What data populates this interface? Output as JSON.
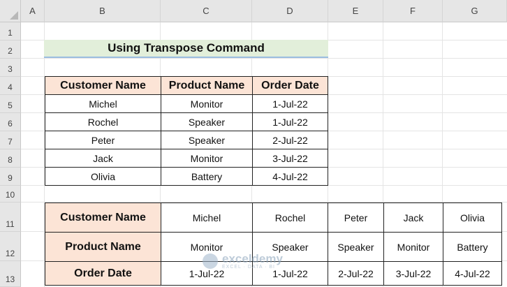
{
  "columns": [
    "A",
    "B",
    "C",
    "D",
    "E",
    "F",
    "G"
  ],
  "rows": [
    "1",
    "2",
    "3",
    "4",
    "5",
    "6",
    "7",
    "8",
    "9",
    "10",
    "11",
    "12",
    "13"
  ],
  "title": "Using Transpose Command",
  "table1": {
    "headers": [
      "Customer Name",
      "Product Name",
      "Order Date"
    ],
    "rows": [
      [
        "Michel",
        "Monitor",
        "1-Jul-22"
      ],
      [
        "Rochel",
        "Speaker",
        "1-Jul-22"
      ],
      [
        "Peter",
        "Speaker",
        "2-Jul-22"
      ],
      [
        "Jack",
        "Monitor",
        "3-Jul-22"
      ],
      [
        "Olivia",
        "Battery",
        "4-Jul-22"
      ]
    ]
  },
  "table2": {
    "rows": [
      {
        "header": "Customer Name",
        "values": [
          "Michel",
          "Rochel",
          "Peter",
          "Jack",
          "Olivia"
        ]
      },
      {
        "header": "Product Name",
        "values": [
          "Monitor",
          "Speaker",
          "Speaker",
          "Monitor",
          "Battery"
        ]
      },
      {
        "header": "Order Date",
        "values": [
          "1-Jul-22",
          "1-Jul-22",
          "2-Jul-22",
          "3-Jul-22",
          "4-Jul-22"
        ]
      }
    ]
  },
  "watermark": {
    "name": "exceldemy",
    "sub": "EXCEL · DATA · BI"
  },
  "colors": {
    "header_fill": "#fce4d6",
    "title_fill": "#e2efda",
    "header_bar": "#e6e6e6"
  }
}
